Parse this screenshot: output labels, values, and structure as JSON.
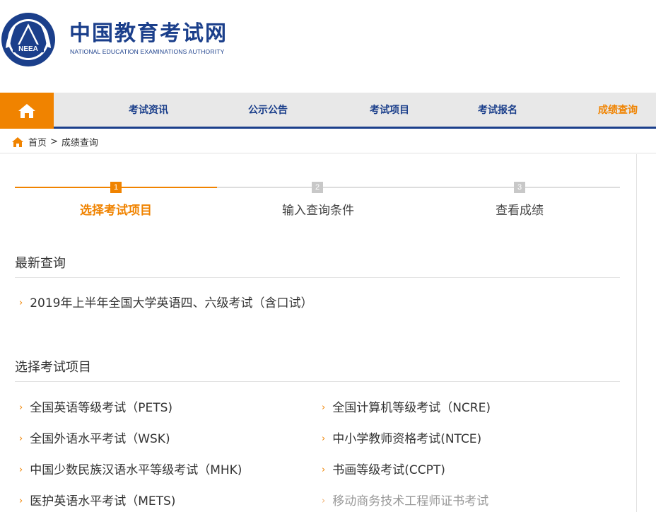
{
  "header": {
    "title": "中国教育考试网",
    "subtitle": "NATIONAL EDUCATION EXAMINATIONS AUTHORITY",
    "logo_text": "NEEA"
  },
  "nav": {
    "items": [
      {
        "label": "考试资讯"
      },
      {
        "label": "公示公告"
      },
      {
        "label": "考试项目"
      },
      {
        "label": "考试报名"
      },
      {
        "label": "成绩查询",
        "active": true
      }
    ]
  },
  "breadcrumb": {
    "home": "首页",
    "separator": ">",
    "current": "成绩查询"
  },
  "steps": [
    {
      "num": "1",
      "label": "选择考试项目",
      "active": true
    },
    {
      "num": "2",
      "label": "输入查询条件"
    },
    {
      "num": "3",
      "label": "查看成绩"
    }
  ],
  "latest": {
    "title": "最新查询",
    "items": [
      "2019年上半年全国大学英语四、六级考试（含口试）"
    ]
  },
  "select": {
    "title": "选择考试项目",
    "left": [
      "全国英语等级考试（PETS)",
      "全国外语水平考试（WSK)",
      "中国少数民族汉语水平等级考试（MHK)",
      "医护英语水平考试（METS)"
    ],
    "right": [
      "全国计算机等级考试（NCRE)",
      "中小学教师资格考试(NTCE)",
      "书画等级考试(CCPT)",
      "移动商务技术工程师证书考试"
    ]
  },
  "colors": {
    "brand_blue": "#1b3f8b",
    "accent_orange": "#f08300"
  }
}
